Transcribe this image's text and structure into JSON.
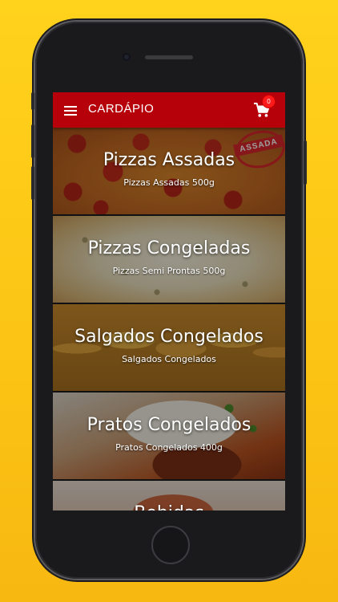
{
  "app": {
    "title": "CARDÁPIO",
    "cart_count": "0",
    "accent_color": "#b6000a",
    "badge_color": "#ff1b1b"
  },
  "icons": {
    "menu": "menu-icon",
    "cart": "cart-icon"
  },
  "categories": [
    {
      "title": "Pizzas Assadas",
      "subtitle": "Pizzas Assadas 500g",
      "stamp": "ASSADA"
    },
    {
      "title": "Pizzas Congeladas",
      "subtitle": "Pizzas Semi Prontas 500g"
    },
    {
      "title": "Salgados Congelados",
      "subtitle": "Salgados Congelados"
    },
    {
      "title": "Pratos Congelados",
      "subtitle": "Pratos Congelados 400g"
    },
    {
      "title": "Bebidas",
      "subtitle": ""
    }
  ]
}
